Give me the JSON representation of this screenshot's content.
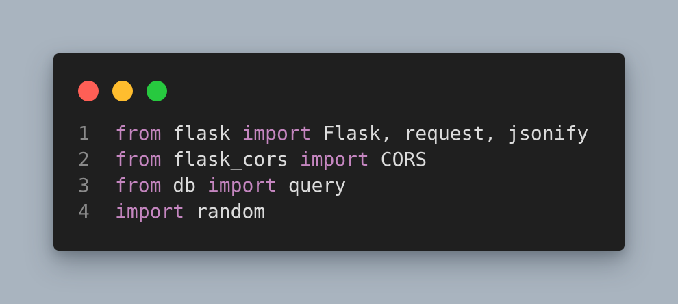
{
  "window": {
    "controls": [
      {
        "name": "close",
        "color": "#ff5f56"
      },
      {
        "name": "minimize",
        "color": "#ffbd2e"
      },
      {
        "name": "maximize",
        "color": "#27c93f"
      }
    ]
  },
  "colors": {
    "background": "#a9b4bf",
    "editor": "#1f1f1f",
    "keyword": "#c586c0",
    "text": "#dcdcdc",
    "line_number": "#8a8a8a"
  },
  "code": {
    "lines": [
      {
        "number": "1",
        "t0": "from",
        "t1": " flask ",
        "t2": "import",
        "t3": " Flask, request, jsonify"
      },
      {
        "number": "2",
        "t0": "from",
        "t1": " flask_cors ",
        "t2": "import",
        "t3": " CORS"
      },
      {
        "number": "3",
        "t0": "from",
        "t1": " db ",
        "t2": "import",
        "t3": " query"
      },
      {
        "number": "4",
        "t0": "import",
        "t1": " random"
      }
    ]
  }
}
